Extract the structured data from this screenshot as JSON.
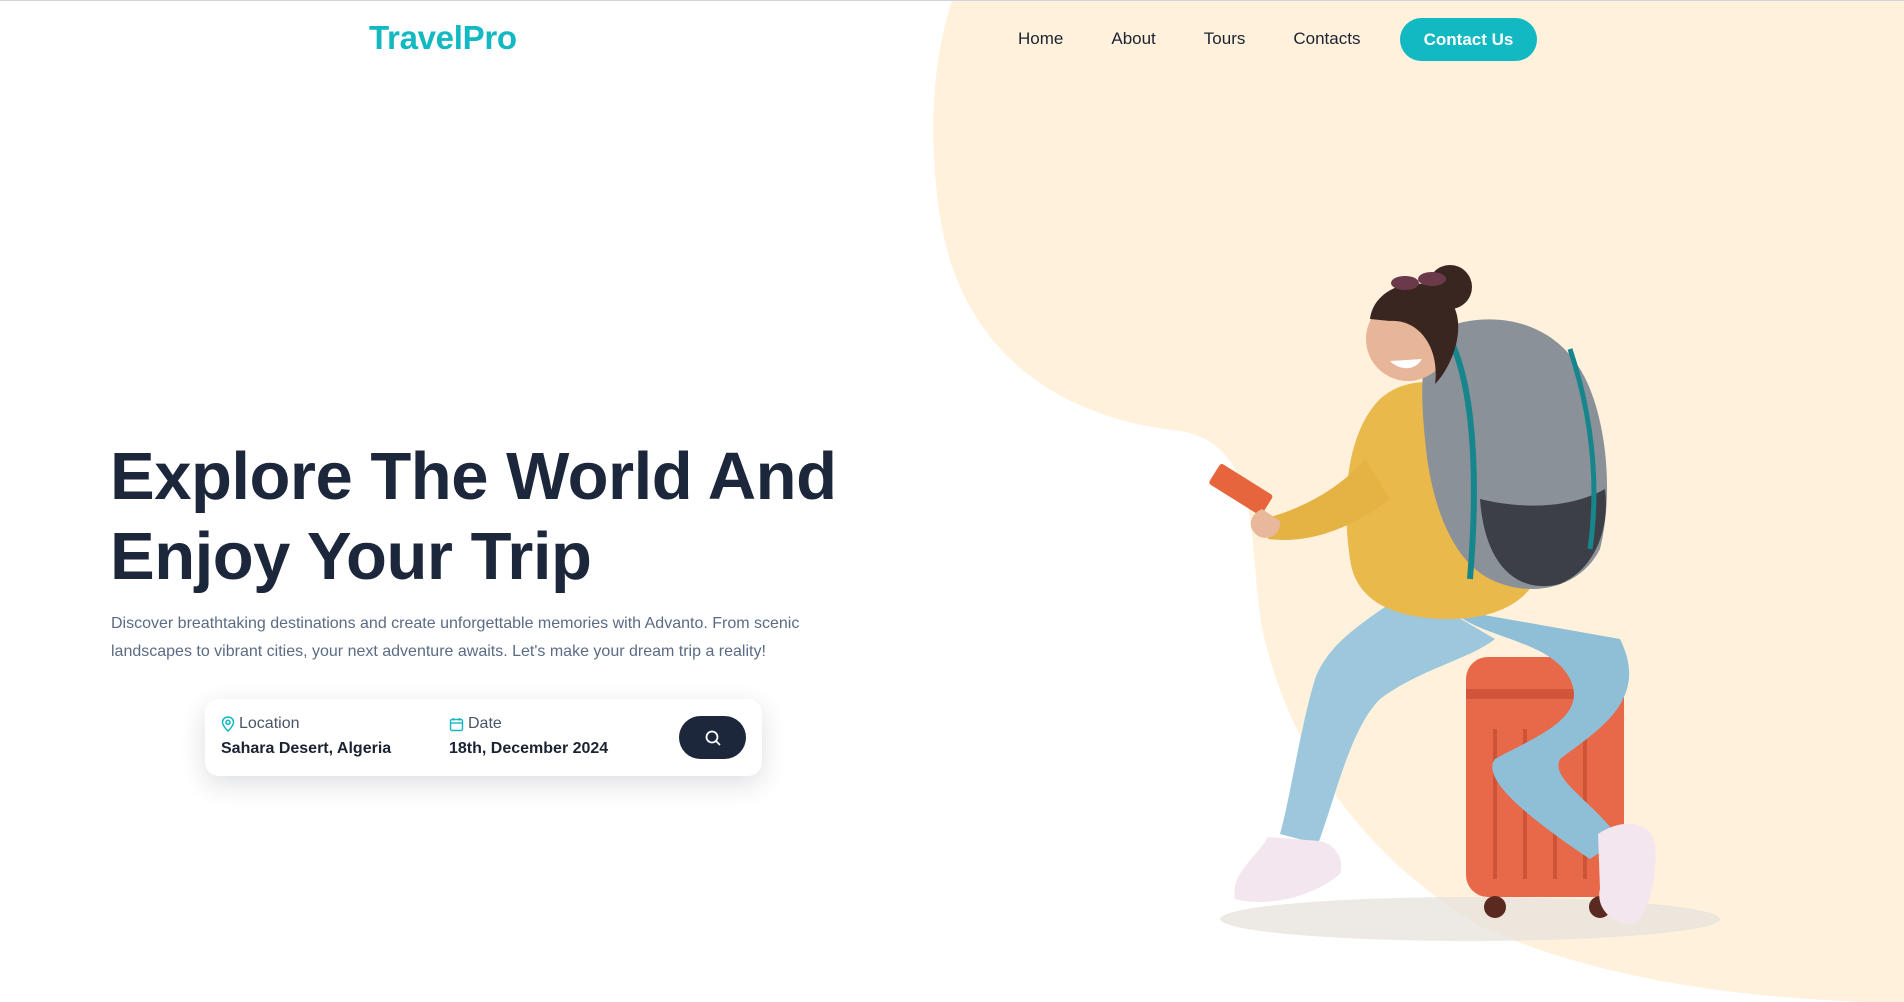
{
  "brand": {
    "logo_text": "TravelPro",
    "accent_color": "#12b8c2",
    "dark_color": "#1c273c",
    "cream_color": "#fff1dc"
  },
  "nav": {
    "items": [
      {
        "label": "Home"
      },
      {
        "label": "About"
      },
      {
        "label": "Tours"
      },
      {
        "label": "Contacts"
      }
    ],
    "cta_label": "Contact Us"
  },
  "hero": {
    "title": "Explore The World And Enjoy Your Trip",
    "description": "Discover breathtaking destinations and create unforgettable memories with Advanto. From scenic landscapes to vibrant cities, your next adventure awaits. Let's make your dream trip a reality!"
  },
  "search": {
    "location": {
      "label": "Location",
      "value": "Sahara Desert, Algeria",
      "icon": "map-pin-icon"
    },
    "date": {
      "label": "Date",
      "value": "18th, December 2024",
      "icon": "calendar-icon"
    },
    "button_icon": "search-icon"
  },
  "illustration": {
    "subject": "traveler-with-backpack-on-suitcase"
  }
}
